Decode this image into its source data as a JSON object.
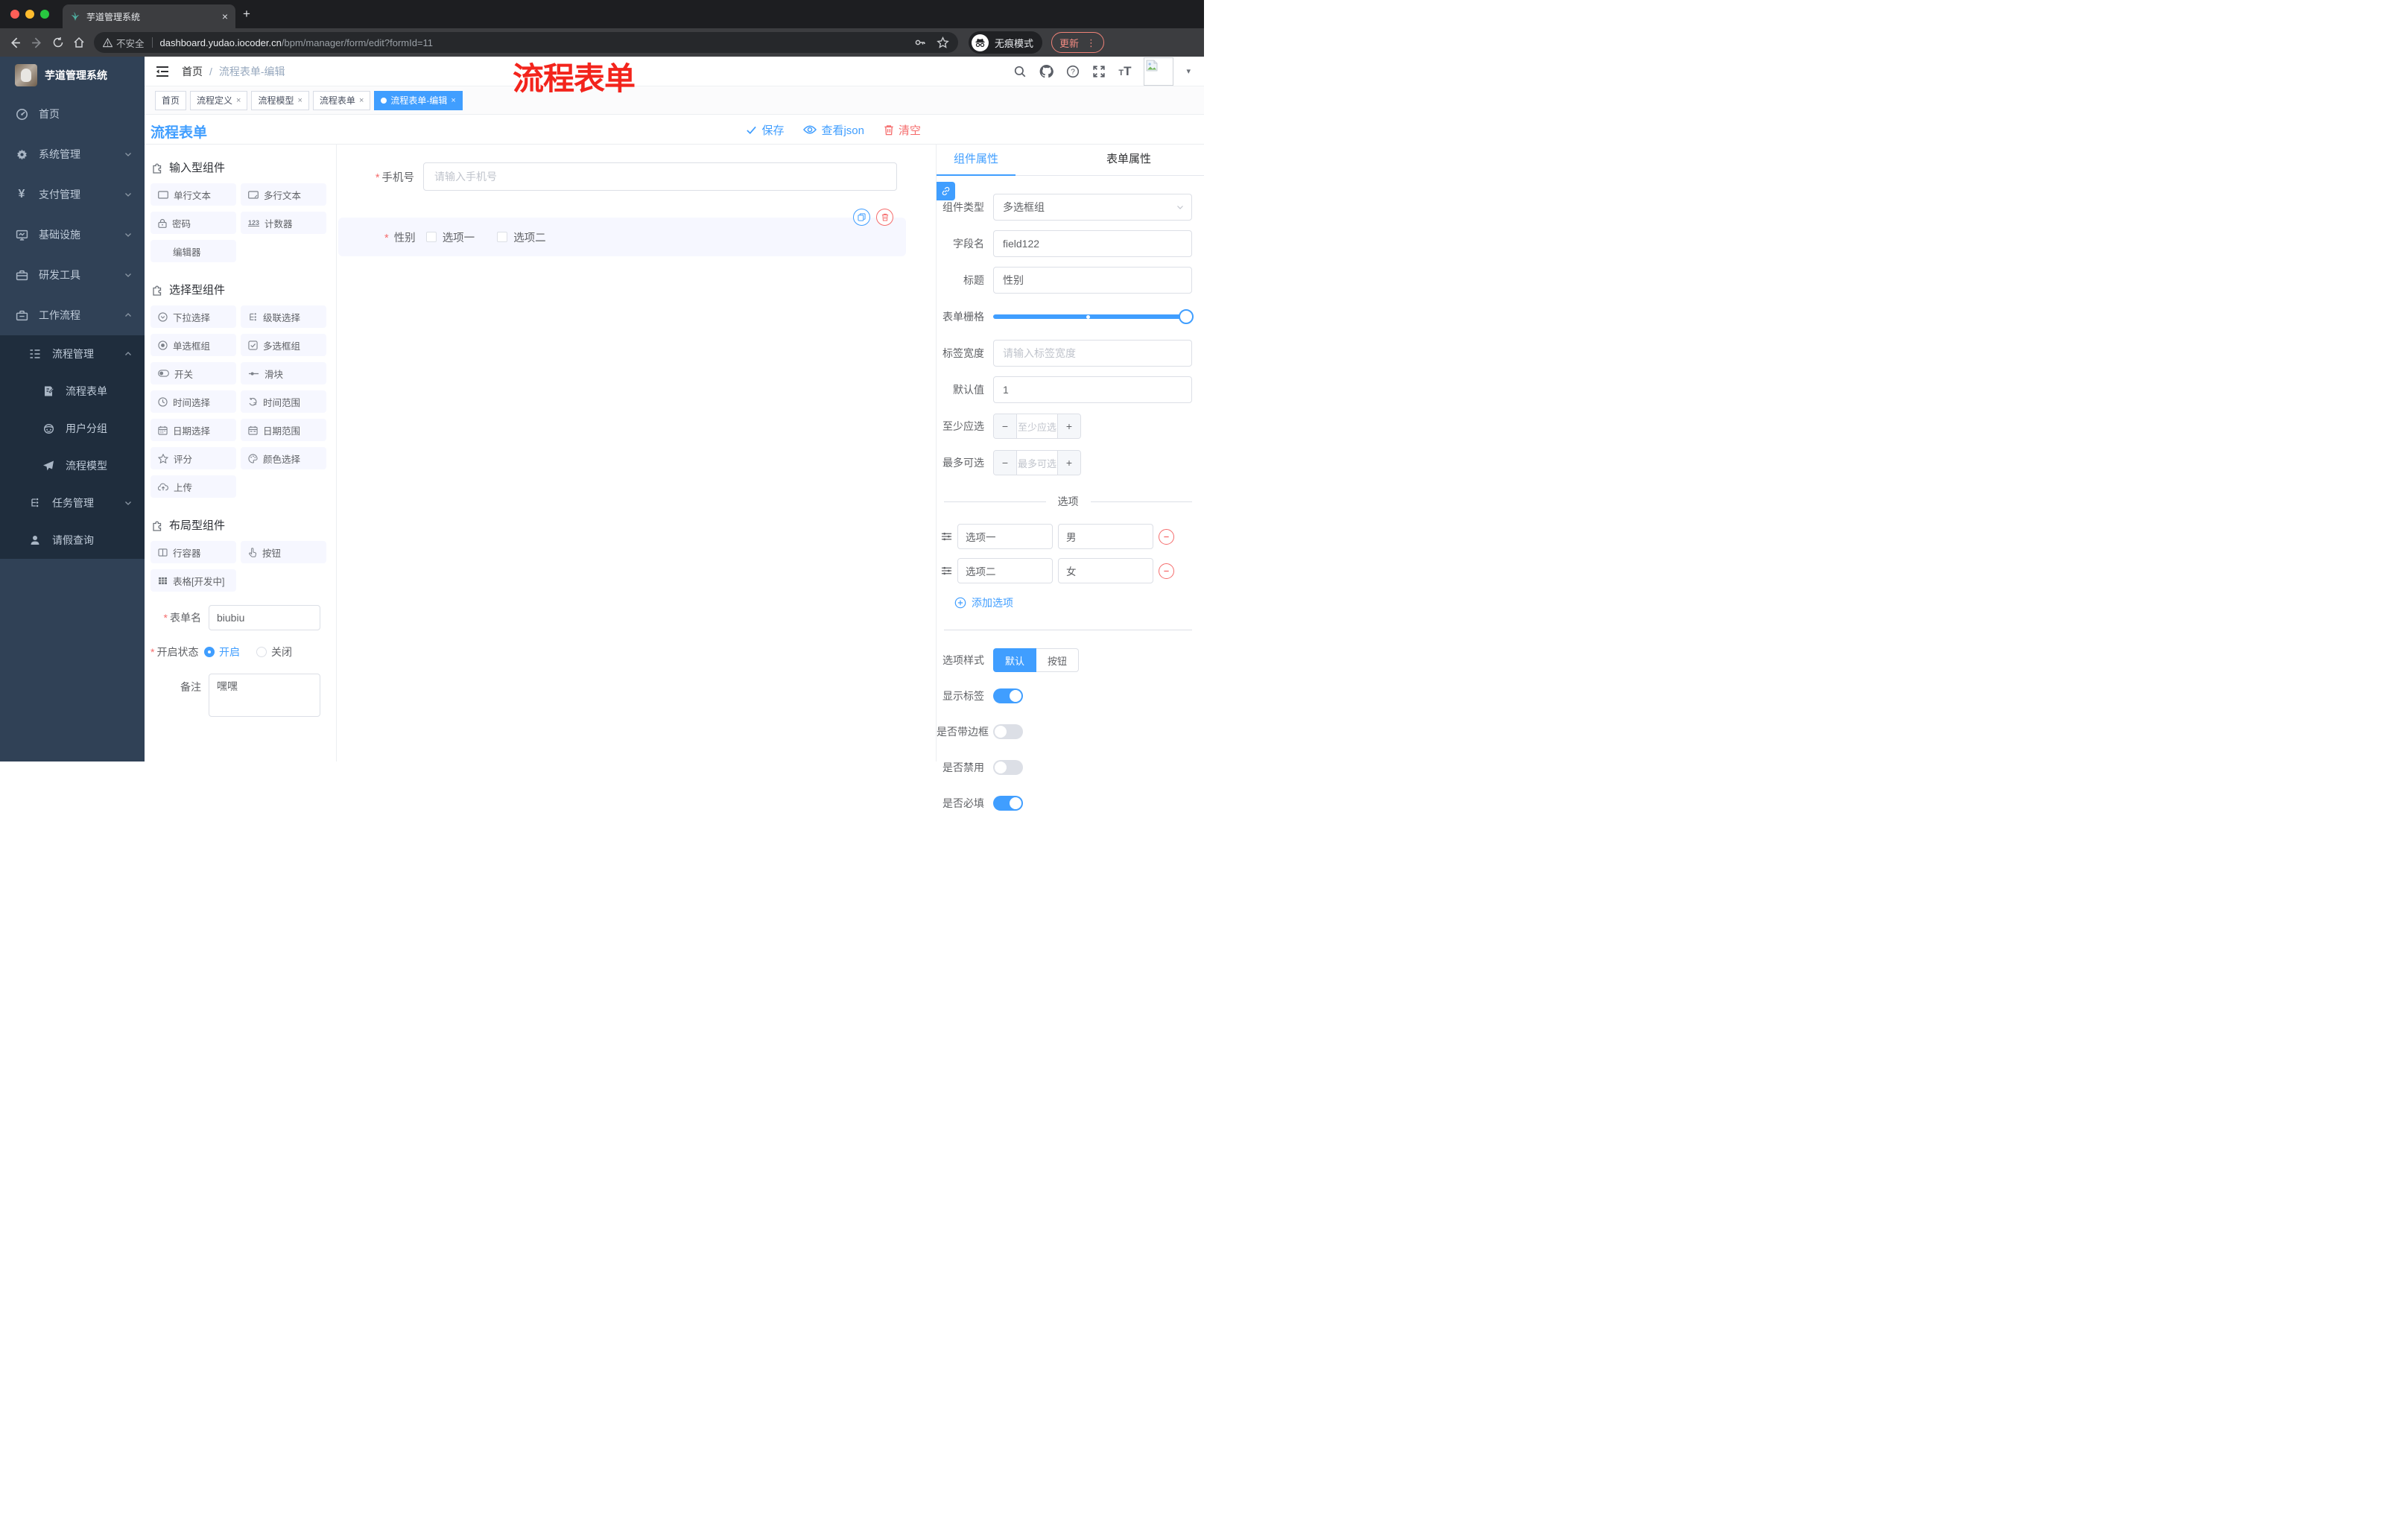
{
  "colors": {
    "accent": "#409eff",
    "danger": "#f56c6c",
    "sidebar_bg": "#304156",
    "submenu_bg": "#1f2d3d",
    "active_tag": "#409eff",
    "selected_block_bg": "#f6f7ff"
  },
  "browser": {
    "tab_title": "芋道管理系统",
    "close_glyph": "×",
    "newtab_glyph": "+",
    "security_label": "不安全",
    "url_host": "dashboard.yudao.iocoder.cn",
    "url_path": "/bpm/manager/form/edit?formId=11",
    "incognito_label": "无痕模式",
    "update_label": "更新",
    "menu_dots": "⋮"
  },
  "annotation": {
    "text": "流程表单"
  },
  "sidebar": {
    "logo_title": "芋道管理系统",
    "items": [
      {
        "label": "首页"
      },
      {
        "label": "系统管理"
      },
      {
        "label": "支付管理"
      },
      {
        "label": "基础设施"
      },
      {
        "label": "研发工具"
      },
      {
        "label": "工作流程"
      },
      {
        "label": "流程管理"
      },
      {
        "label": "流程表单"
      },
      {
        "label": "用户分组"
      },
      {
        "label": "流程模型"
      },
      {
        "label": "任务管理"
      },
      {
        "label": "请假查询"
      }
    ]
  },
  "header": {
    "breadcrumb_home": "首页",
    "breadcrumb_sep": "/",
    "breadcrumb_current": "流程表单-编辑",
    "font_icon_small": "T",
    "font_icon_big": "T",
    "caret_glyph": "▾",
    "help_glyph": "?"
  },
  "tags": [
    {
      "label": "首页"
    },
    {
      "label": "流程定义",
      "close": "×"
    },
    {
      "label": "流程模型",
      "close": "×"
    },
    {
      "label": "流程表单",
      "close": "×"
    },
    {
      "label": "流程表单-编辑",
      "close": "×"
    }
  ],
  "designer": {
    "title": "流程表单",
    "save_label": "保存",
    "view_json_label": "查看json",
    "clear_label": "清空"
  },
  "components_panel": {
    "sections": [
      {
        "title": "输入型组件",
        "items": [
          {
            "label": "单行文本"
          },
          {
            "label": "多行文本"
          },
          {
            "label": "密码"
          },
          {
            "label": "计数器"
          },
          {
            "label": "编辑器"
          }
        ]
      },
      {
        "title": "选择型组件",
        "items": [
          {
            "label": "下拉选择"
          },
          {
            "label": "级联选择"
          },
          {
            "label": "单选框组"
          },
          {
            "label": "多选框组"
          },
          {
            "label": "开关"
          },
          {
            "label": "滑块"
          },
          {
            "label": "时间选择"
          },
          {
            "label": "时间范围"
          },
          {
            "label": "日期选择"
          },
          {
            "label": "日期范围"
          },
          {
            "label": "评分"
          },
          {
            "label": "颜色选择"
          },
          {
            "label": "上传"
          }
        ]
      },
      {
        "title": "布局型组件",
        "items": [
          {
            "label": "行容器"
          },
          {
            "label": "按钮"
          },
          {
            "label": "表格[开发中]"
          }
        ]
      }
    ],
    "counter_icon_text": "123",
    "required_mark": "*",
    "form": {
      "name_label": "表单名",
      "name_value": "biubiu",
      "status_label": "开启状态",
      "status_on": "开启",
      "status_off": "关闭",
      "remark_label": "备注",
      "remark_value": "嘿嘿"
    }
  },
  "canvas": {
    "phone_label": "手机号",
    "phone_placeholder": "请输入手机号",
    "gender_label": "性别",
    "gender_options": [
      {
        "label": "选项一"
      },
      {
        "label": "选项二"
      }
    ],
    "required_mark": "*"
  },
  "props_panel": {
    "tab_component": "组件属性",
    "tab_form": "表单属性",
    "component_type_label": "组件类型",
    "component_type_value": "多选框组",
    "field_name_label": "字段名",
    "field_name_value": "field122",
    "title_label": "标题",
    "title_value": "性别",
    "grid_label": "表单栅格",
    "label_width_label": "标签宽度",
    "label_width_placeholder": "请输入标签宽度",
    "default_label": "默认值",
    "default_value": "1",
    "min_label": "至少应选",
    "min_placeholder": "至少应选",
    "max_label": "最多可选",
    "max_placeholder": "最多可选",
    "minus_glyph": "−",
    "plus_glyph": "+",
    "options_title": "选项",
    "options": [
      {
        "label": "选项一",
        "value": "男"
      },
      {
        "label": "选项二",
        "value": "女"
      }
    ],
    "add_option_label": "添加选项",
    "style_label": "选项样式",
    "style_default": "默认",
    "style_button": "按钮",
    "show_label_label": "显示标签",
    "border_label": "是否带边框",
    "disabled_label": "是否禁用",
    "required_label": "是否必填"
  }
}
